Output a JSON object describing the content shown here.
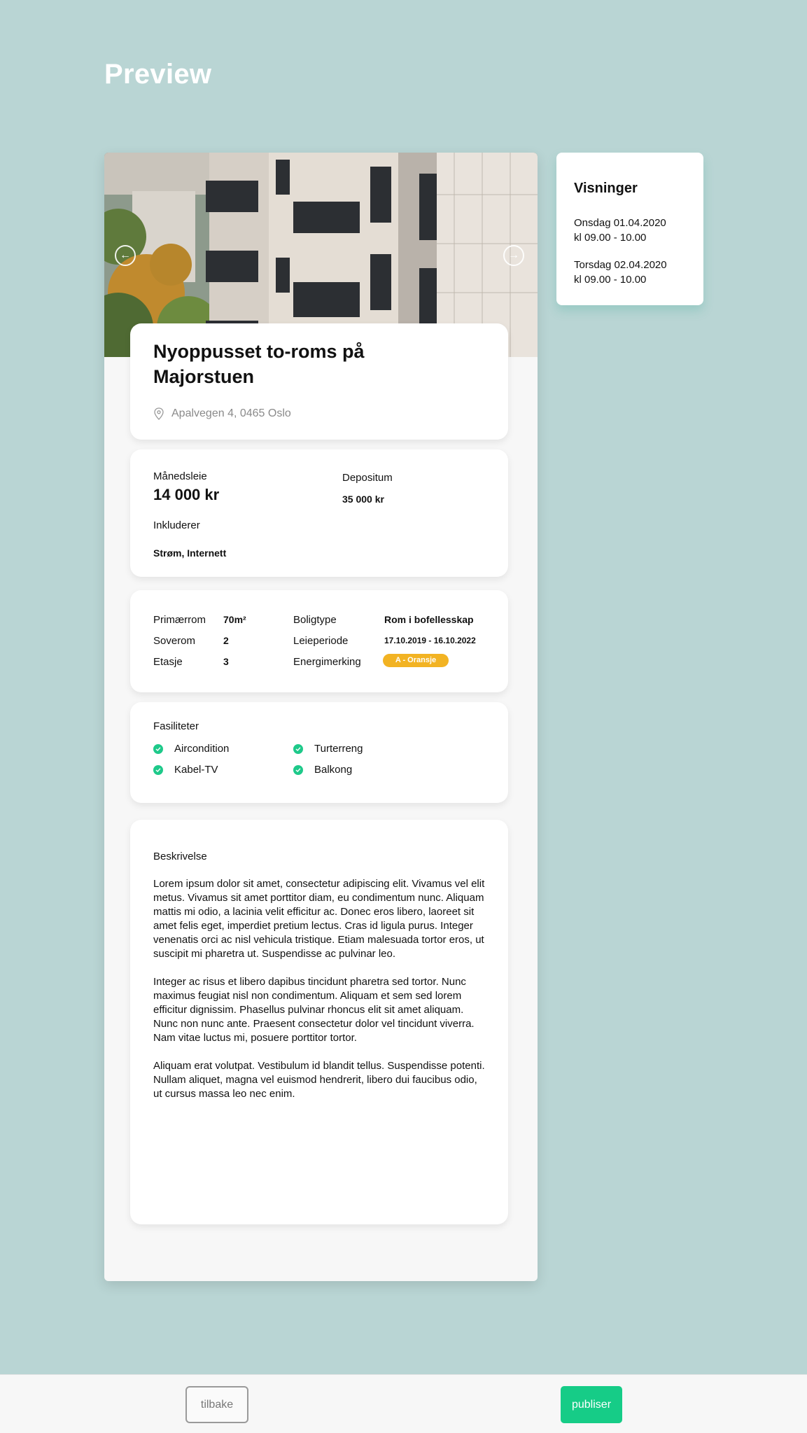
{
  "page": {
    "title": "Preview"
  },
  "listing": {
    "title": "Nyoppusset to-roms på Majorstuen",
    "address": "Apalvegen 4, 0465 Oslo",
    "price": {
      "rent_label": "Månedsleie",
      "rent_value": "14 000 kr",
      "deposit_label": "Depositum",
      "deposit_value": "35 000 kr",
      "includes_label": "Inkluderer",
      "includes_value": "Strøm, Internett"
    },
    "details": {
      "primary_room_label": "Primærrom",
      "primary_room_value": "70m²",
      "bedrooms_label": "Soverom",
      "bedrooms_value": "2",
      "floor_label": "Etasje",
      "floor_value": "3",
      "type_label": "Boligtype",
      "type_value": "Rom i bofellesskap",
      "period_label": "Leieperiode",
      "period_value": "17.10.2019 - 16.10.2022",
      "energy_label": "Energimerking",
      "energy_value": "A - Oransje"
    },
    "facilities": {
      "title": "Fasiliteter",
      "items": [
        "Aircondition",
        "Kabel-TV",
        "Turterreng",
        "Balkong"
      ]
    },
    "description": {
      "title": "Beskrivelse",
      "paragraphs": [
        "Lorem ipsum dolor sit amet, consectetur adipiscing elit. Vivamus vel elit metus. Vivamus sit amet porttitor diam, eu condimentum nunc. Aliquam mattis mi odio, a lacinia velit efficitur ac. Donec eros libero, laoreet sit amet felis eget, imperdiet pretium lectus. Cras id ligula purus. Integer venenatis orci ac nisl vehicula tristique. Etiam malesuada tortor eros, ut suscipit mi pharetra ut. Suspendisse ac pulvinar leo.",
        "Integer ac risus et libero dapibus tincidunt pharetra sed tortor. Nunc maximus feugiat nisl non condimentum. Aliquam et sem sed lorem efficitur dignissim. Phasellus pulvinar rhoncus elit sit amet aliquam. Nunc non nunc ante. Praesent consectetur dolor vel tincidunt viverra. Nam vitae luctus mi, posuere porttitor tortor.",
        "Aliquam erat volutpat. Vestibulum id blandit tellus. Suspendisse potenti. Nullam aliquet, magna vel euismod hendrerit, libero dui faucibus odio, ut cursus massa leo nec enim."
      ]
    }
  },
  "viewings": {
    "title": "Visninger",
    "items": [
      {
        "day": "Onsdag 01.04.2020",
        "time": "kl 09.00 - 10.00"
      },
      {
        "day": "Torsdag 02.04.2020",
        "time": "kl 09.00 - 10.00"
      }
    ]
  },
  "footer": {
    "back_label": "tilbake",
    "publish_label": "publiser"
  },
  "colors": {
    "background": "#b9d5d4",
    "accent_green": "#16cc87",
    "energy_badge": "#f2b323"
  },
  "icons": {
    "prev": "arrow-left-circle-icon",
    "next": "arrow-right-circle-icon",
    "address": "map-pin-icon",
    "facility": "check-circle-icon"
  }
}
